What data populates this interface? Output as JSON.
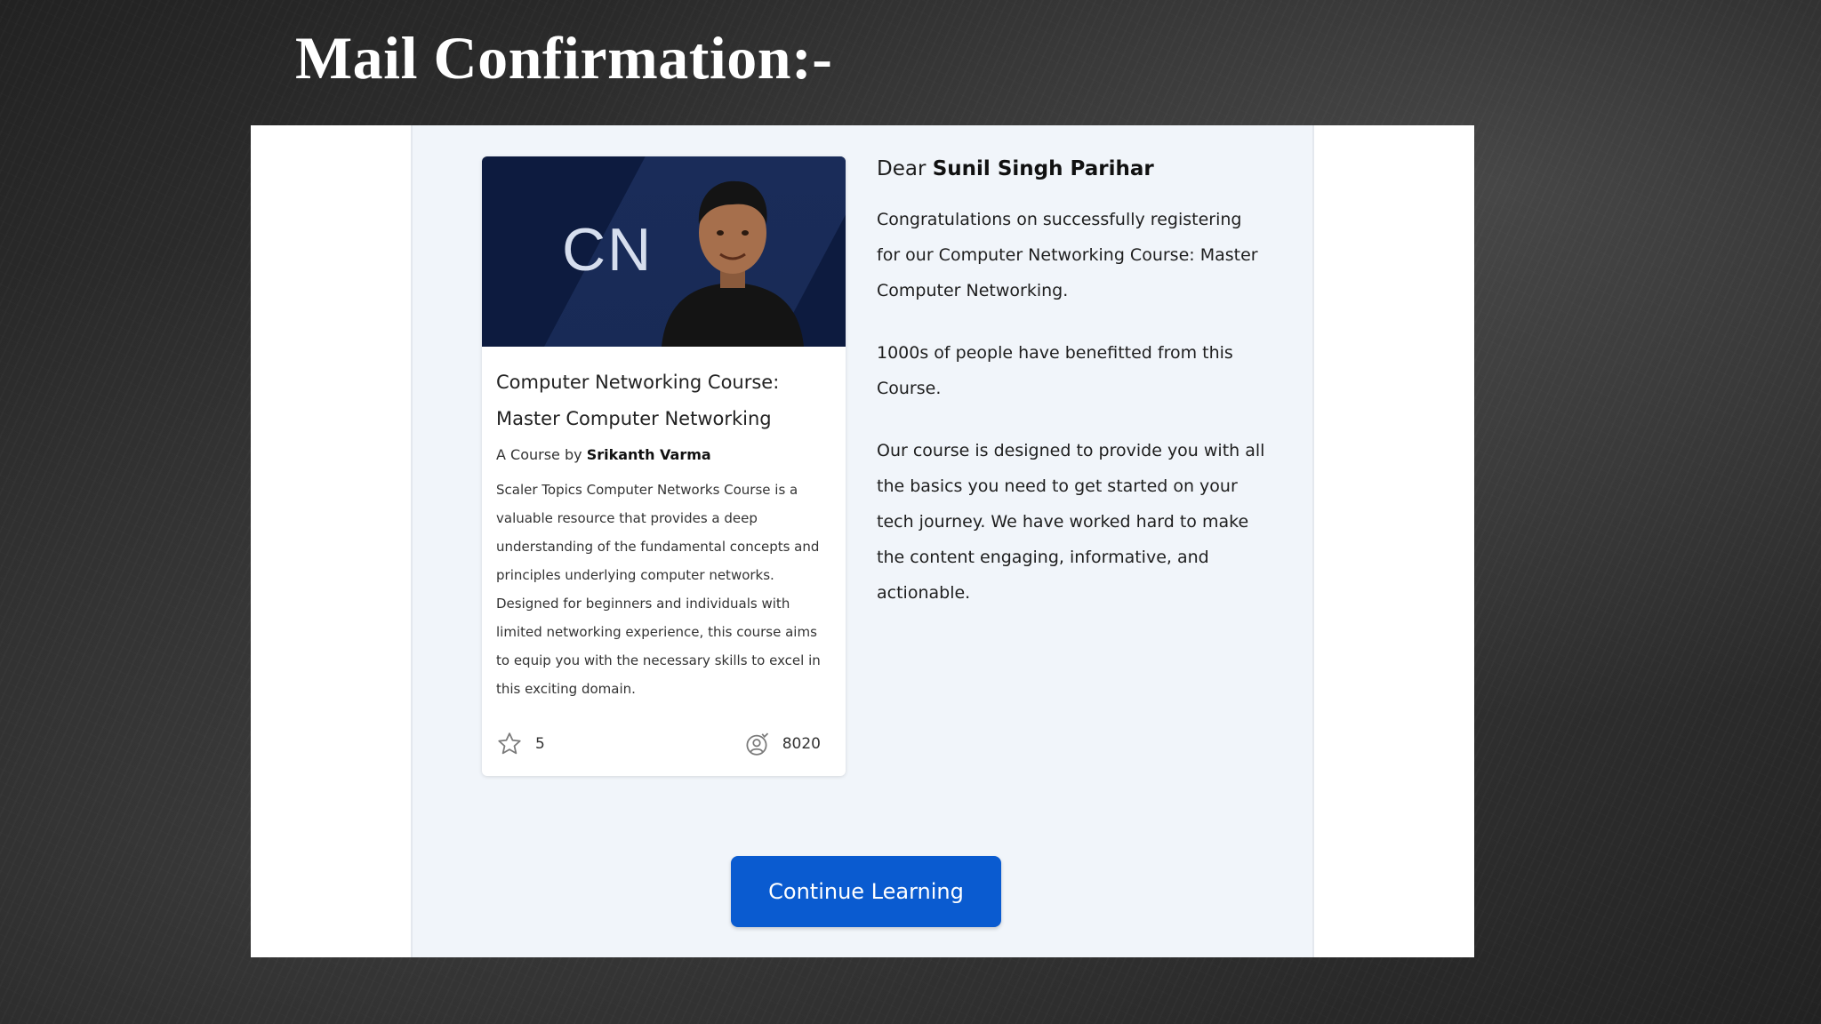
{
  "slide": {
    "title": "Mail Confirmation:-"
  },
  "course_card": {
    "banner_code": "CN",
    "title": "Computer Networking Course: Master Computer Networking",
    "by_prefix": "A Course by",
    "instructor": "Srikanth Varma",
    "description": "Scaler Topics Computer Networks Course is a valuable resource that provides a deep understanding of the fundamental concepts and principles underlying computer networks. Designed for beginners and individuals with limited networking experience, this course aims to equip you with the necessary skills to excel in this exciting domain.",
    "rating": "5",
    "learners": "8020",
    "icons": {
      "rating": "star-icon",
      "learners": "learner-badge-icon",
      "photo": "instructor-photo"
    }
  },
  "message": {
    "greeting_prefix": "Dear",
    "recipient": "Sunil Singh Parihar",
    "paragraph_1": "Congratulations on successfully registering for our Computer Networking Course: Master Computer Networking.",
    "paragraph_2": "1000s of people have benefitted from this Course.",
    "paragraph_3": "Our course is designed to provide you with all the basics you need to get started on your tech journey. We have worked hard to make the content engaging, informative, and actionable."
  },
  "cta": {
    "label": "Continue Learning"
  },
  "colors": {
    "background": "#2f2f2f",
    "email_body": "#f1f5fa",
    "banner": "#0d1b3f",
    "button": "#0a5bd0"
  }
}
